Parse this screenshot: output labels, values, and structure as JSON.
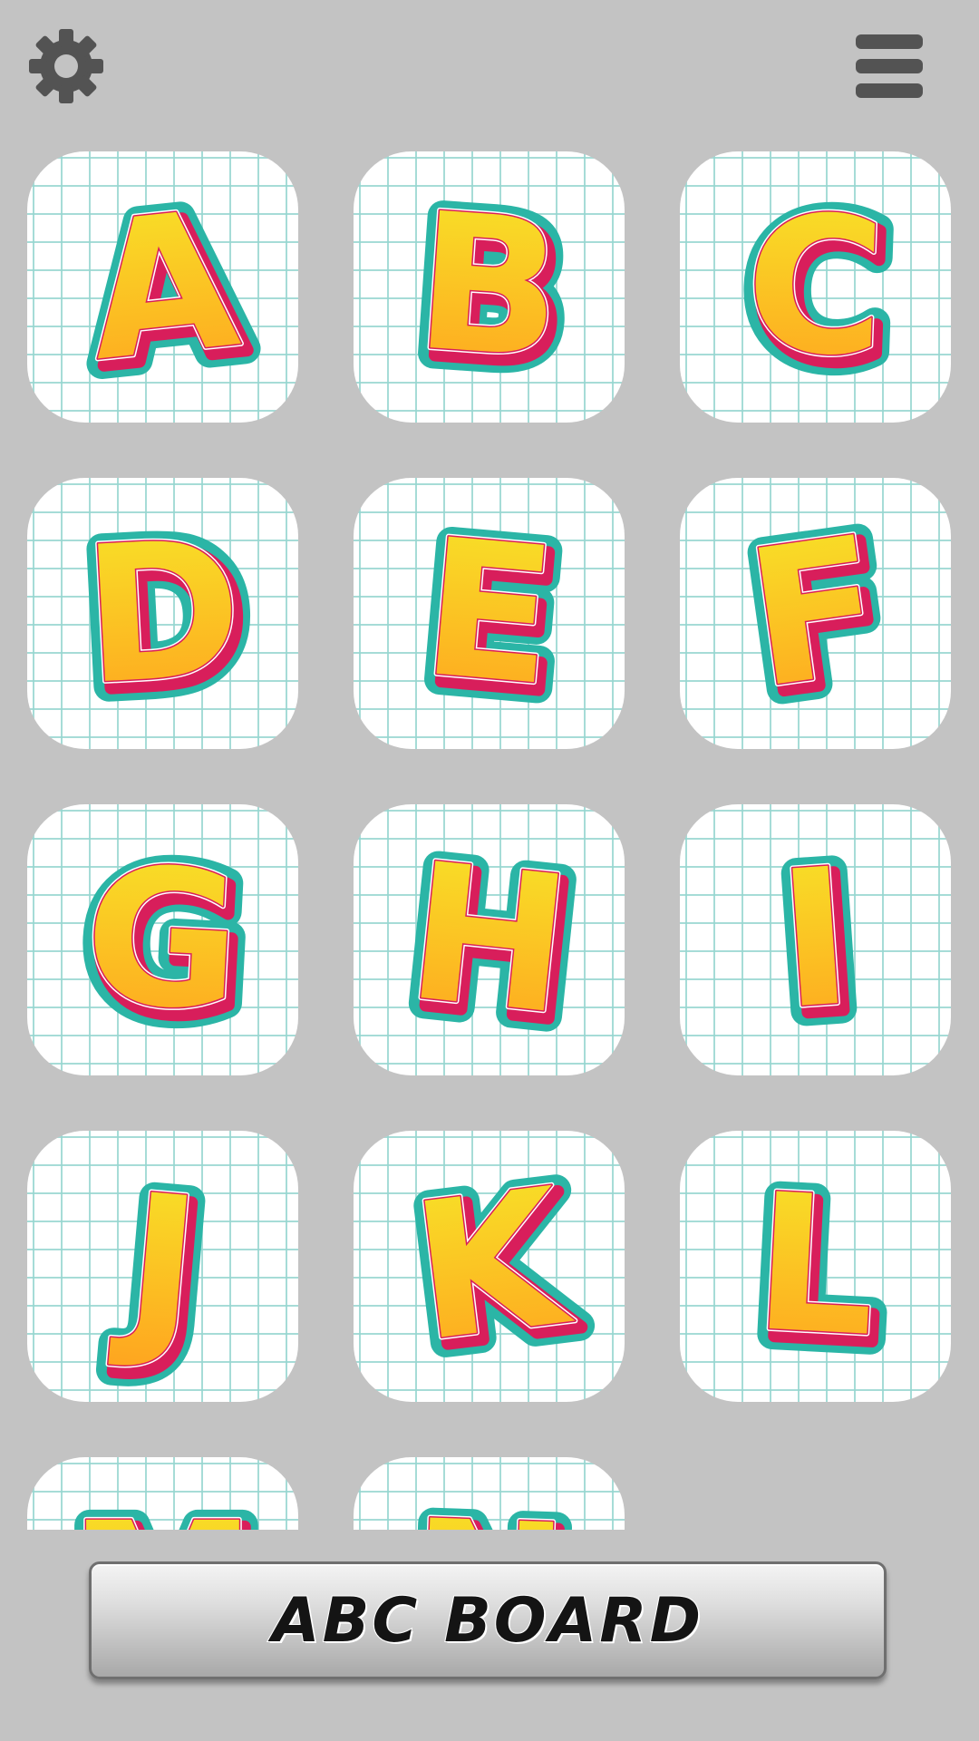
{
  "topbar": {
    "settings_icon": "gear-icon",
    "menu_icon": "hamburger-menu-icon",
    "icon_color": "#535353"
  },
  "tiles": [
    {
      "letter": "A"
    },
    {
      "letter": "B"
    },
    {
      "letter": "C"
    },
    {
      "letter": "D"
    },
    {
      "letter": "E"
    },
    {
      "letter": "F"
    },
    {
      "letter": "G"
    },
    {
      "letter": "H"
    },
    {
      "letter": "I"
    },
    {
      "letter": "J"
    },
    {
      "letter": "K"
    },
    {
      "letter": "L"
    },
    {
      "letter": "M"
    },
    {
      "letter": "N"
    }
  ],
  "colors": {
    "background": "#c3c3c3",
    "tile_background": "#ffffff",
    "grid_line": "#96d6d0",
    "letter_outline": "#2bb5a6",
    "letter_edge": "#d81e5b",
    "letter_fill_top": "#f7e628",
    "letter_fill_bottom": "#ffa31f"
  },
  "bottom": {
    "button_label": "ABC BOARD"
  }
}
